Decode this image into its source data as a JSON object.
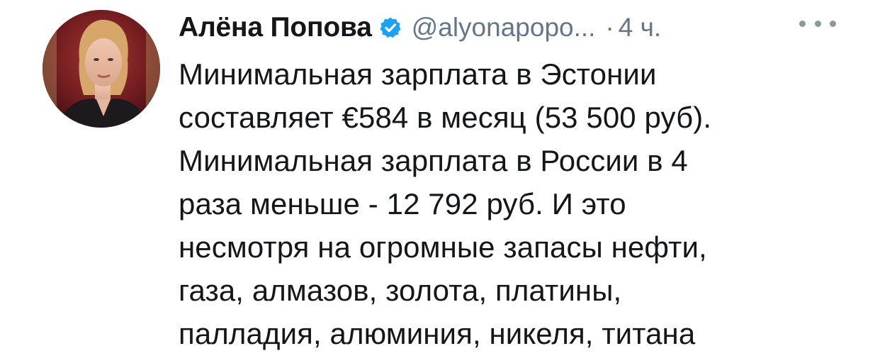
{
  "tweet": {
    "author": {
      "name": "Алёна Попова",
      "handle": "@alyonapopo...",
      "verified": true
    },
    "separator": "·",
    "time": "4 ч.",
    "more_icon": "ellipsis-icon",
    "text_lines": [
      "Минимальная зарплата в Эстонии",
      "составляет €584 в месяц (53 500 руб).",
      "Минимальная зарплата в России в 4",
      "раза меньше - 12 792 руб. И это",
      "несмотря на огромные запасы нефти,",
      "газа, алмазов, золота, платины,",
      "палладия, алюминия, никеля, титана"
    ]
  },
  "colors": {
    "text": "#14171a",
    "secondary": "#657786",
    "verified_badge": "#1da1f2",
    "more_dots": "#8899a6"
  }
}
